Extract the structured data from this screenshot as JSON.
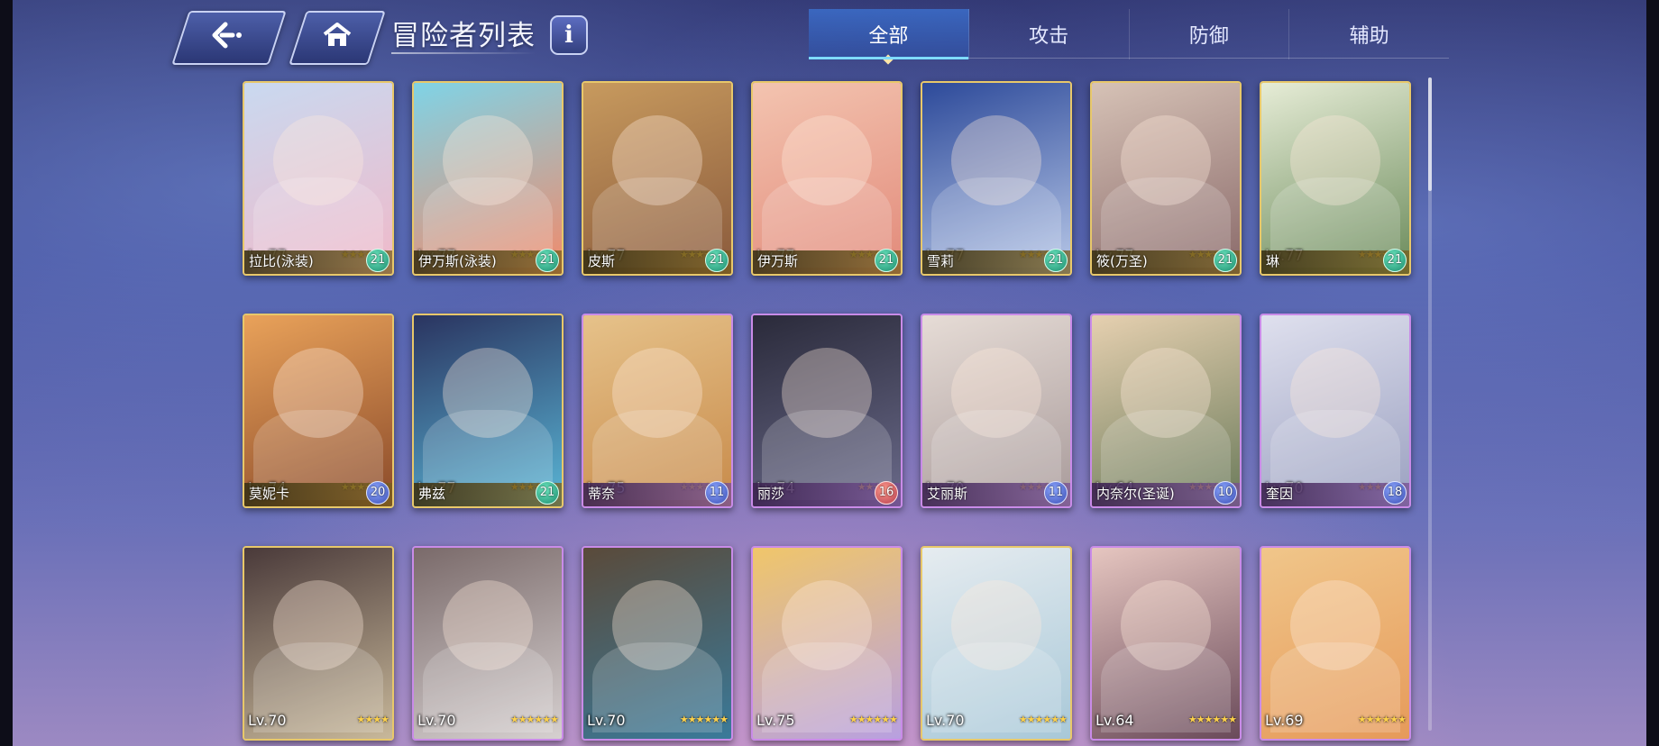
{
  "header": {
    "back_icon": "back-arrow-icon",
    "home_icon": "home-icon",
    "title": "冒险者列表",
    "info_icon": "i"
  },
  "tabs": [
    {
      "label": "全部",
      "active": true
    },
    {
      "label": "攻击",
      "active": false
    },
    {
      "label": "防御",
      "active": false
    },
    {
      "label": "辅助",
      "active": false
    }
  ],
  "cards": [
    {
      "level": "Lv.77",
      "name": "拉比(泳装)",
      "badge": "21",
      "stars": 6,
      "frame": "gold",
      "colors": [
        "#c9d9f0",
        "#f0b9c9"
      ]
    },
    {
      "level": "Lv.77",
      "name": "伊万斯(泳装)",
      "badge": "21",
      "stars": 6,
      "frame": "gold",
      "colors": [
        "#7fd3e6",
        "#f28a6a"
      ]
    },
    {
      "level": "Lv.77",
      "name": "皮斯",
      "badge": "21",
      "stars": 6,
      "frame": "gold",
      "colors": [
        "#c79a5e",
        "#8a5a3c"
      ]
    },
    {
      "level": "Lv.77",
      "name": "伊万斯",
      "badge": "21",
      "stars": 6,
      "frame": "gold",
      "colors": [
        "#f3c4b0",
        "#e28a7a"
      ]
    },
    {
      "level": "Lv.77",
      "name": "雪莉",
      "badge": "21",
      "stars": 6,
      "frame": "gold",
      "colors": [
        "#2d4a9a",
        "#b8c8e8"
      ]
    },
    {
      "level": "Lv.77",
      "name": "筱(万圣)",
      "badge": "21",
      "stars": 6,
      "frame": "gold",
      "colors": [
        "#d6c2b6",
        "#8a6a6a"
      ]
    },
    {
      "level": "Lv.77",
      "name": "琳",
      "badge": "21",
      "stars": 6,
      "frame": "gold",
      "colors": [
        "#e6ecd6",
        "#6a8a5a"
      ]
    },
    {
      "level": "Lv.74",
      "name": "莫妮卡",
      "badge": "20",
      "stars": 6,
      "frame": "gold",
      "colors": [
        "#e9a25a",
        "#8a4a2a"
      ],
      "badge_color": "blue"
    },
    {
      "level": "Lv.77",
      "name": "弗兹",
      "badge": "21",
      "stars": 6,
      "frame": "gold",
      "colors": [
        "#2a3460",
        "#5ab6d6"
      ]
    },
    {
      "level": "Lv.75",
      "name": "蒂奈",
      "badge": "11",
      "stars": 6,
      "frame": "purple",
      "colors": [
        "#e6c28a",
        "#c78a4a"
      ],
      "badge_color": "blue"
    },
    {
      "level": "Lv.74",
      "name": "丽莎",
      "badge": "16",
      "stars": 5,
      "frame": "purple",
      "colors": [
        "#2a2a3a",
        "#6a6a8a"
      ],
      "badge_color": "red"
    },
    {
      "level": "Lv.70",
      "name": "艾丽斯",
      "badge": "11",
      "stars": 6,
      "frame": "purple",
      "colors": [
        "#e6dcd6",
        "#a89a9a"
      ],
      "badge_color": "blue"
    },
    {
      "level": "Lv.64",
      "name": "内奈尔(圣诞)",
      "badge": "10",
      "stars": 6,
      "frame": "purple",
      "colors": [
        "#e6d0b0",
        "#6a7a5a"
      ],
      "badge_color": "blue"
    },
    {
      "level": "Lv.70",
      "name": "奎因",
      "badge": "18",
      "stars": 6,
      "frame": "purple",
      "colors": [
        "#dfe0ee",
        "#9aa0c0"
      ],
      "badge_color": "blue"
    },
    {
      "level": "Lv.70",
      "name": "",
      "badge": "",
      "stars": 4,
      "frame": "gold",
      "colors": [
        "#4a3a3a",
        "#c8b89a"
      ]
    },
    {
      "level": "Lv.70",
      "name": "",
      "badge": "",
      "stars": 6,
      "frame": "purple",
      "colors": [
        "#7a6a6a",
        "#d6d0d0"
      ]
    },
    {
      "level": "Lv.70",
      "name": "",
      "badge": "",
      "stars": 6,
      "frame": "purple",
      "colors": [
        "#5a4a3a",
        "#3a7a9a"
      ]
    },
    {
      "level": "Lv.75",
      "name": "",
      "badge": "",
      "stars": 6,
      "frame": "purple",
      "colors": [
        "#f0c66a",
        "#b8a0e0"
      ]
    },
    {
      "level": "Lv.70",
      "name": "",
      "badge": "",
      "stars": 6,
      "frame": "gold",
      "colors": [
        "#e6ecf0",
        "#a8c8d8"
      ]
    },
    {
      "level": "Lv.64",
      "name": "",
      "badge": "",
      "stars": 6,
      "frame": "purple",
      "colors": [
        "#e6c6c0",
        "#6a4a5a"
      ]
    },
    {
      "level": "Lv.69",
      "name": "",
      "badge": "",
      "stars": 6,
      "frame": "purple",
      "colors": [
        "#f0c68a",
        "#e69a5a"
      ]
    }
  ]
}
